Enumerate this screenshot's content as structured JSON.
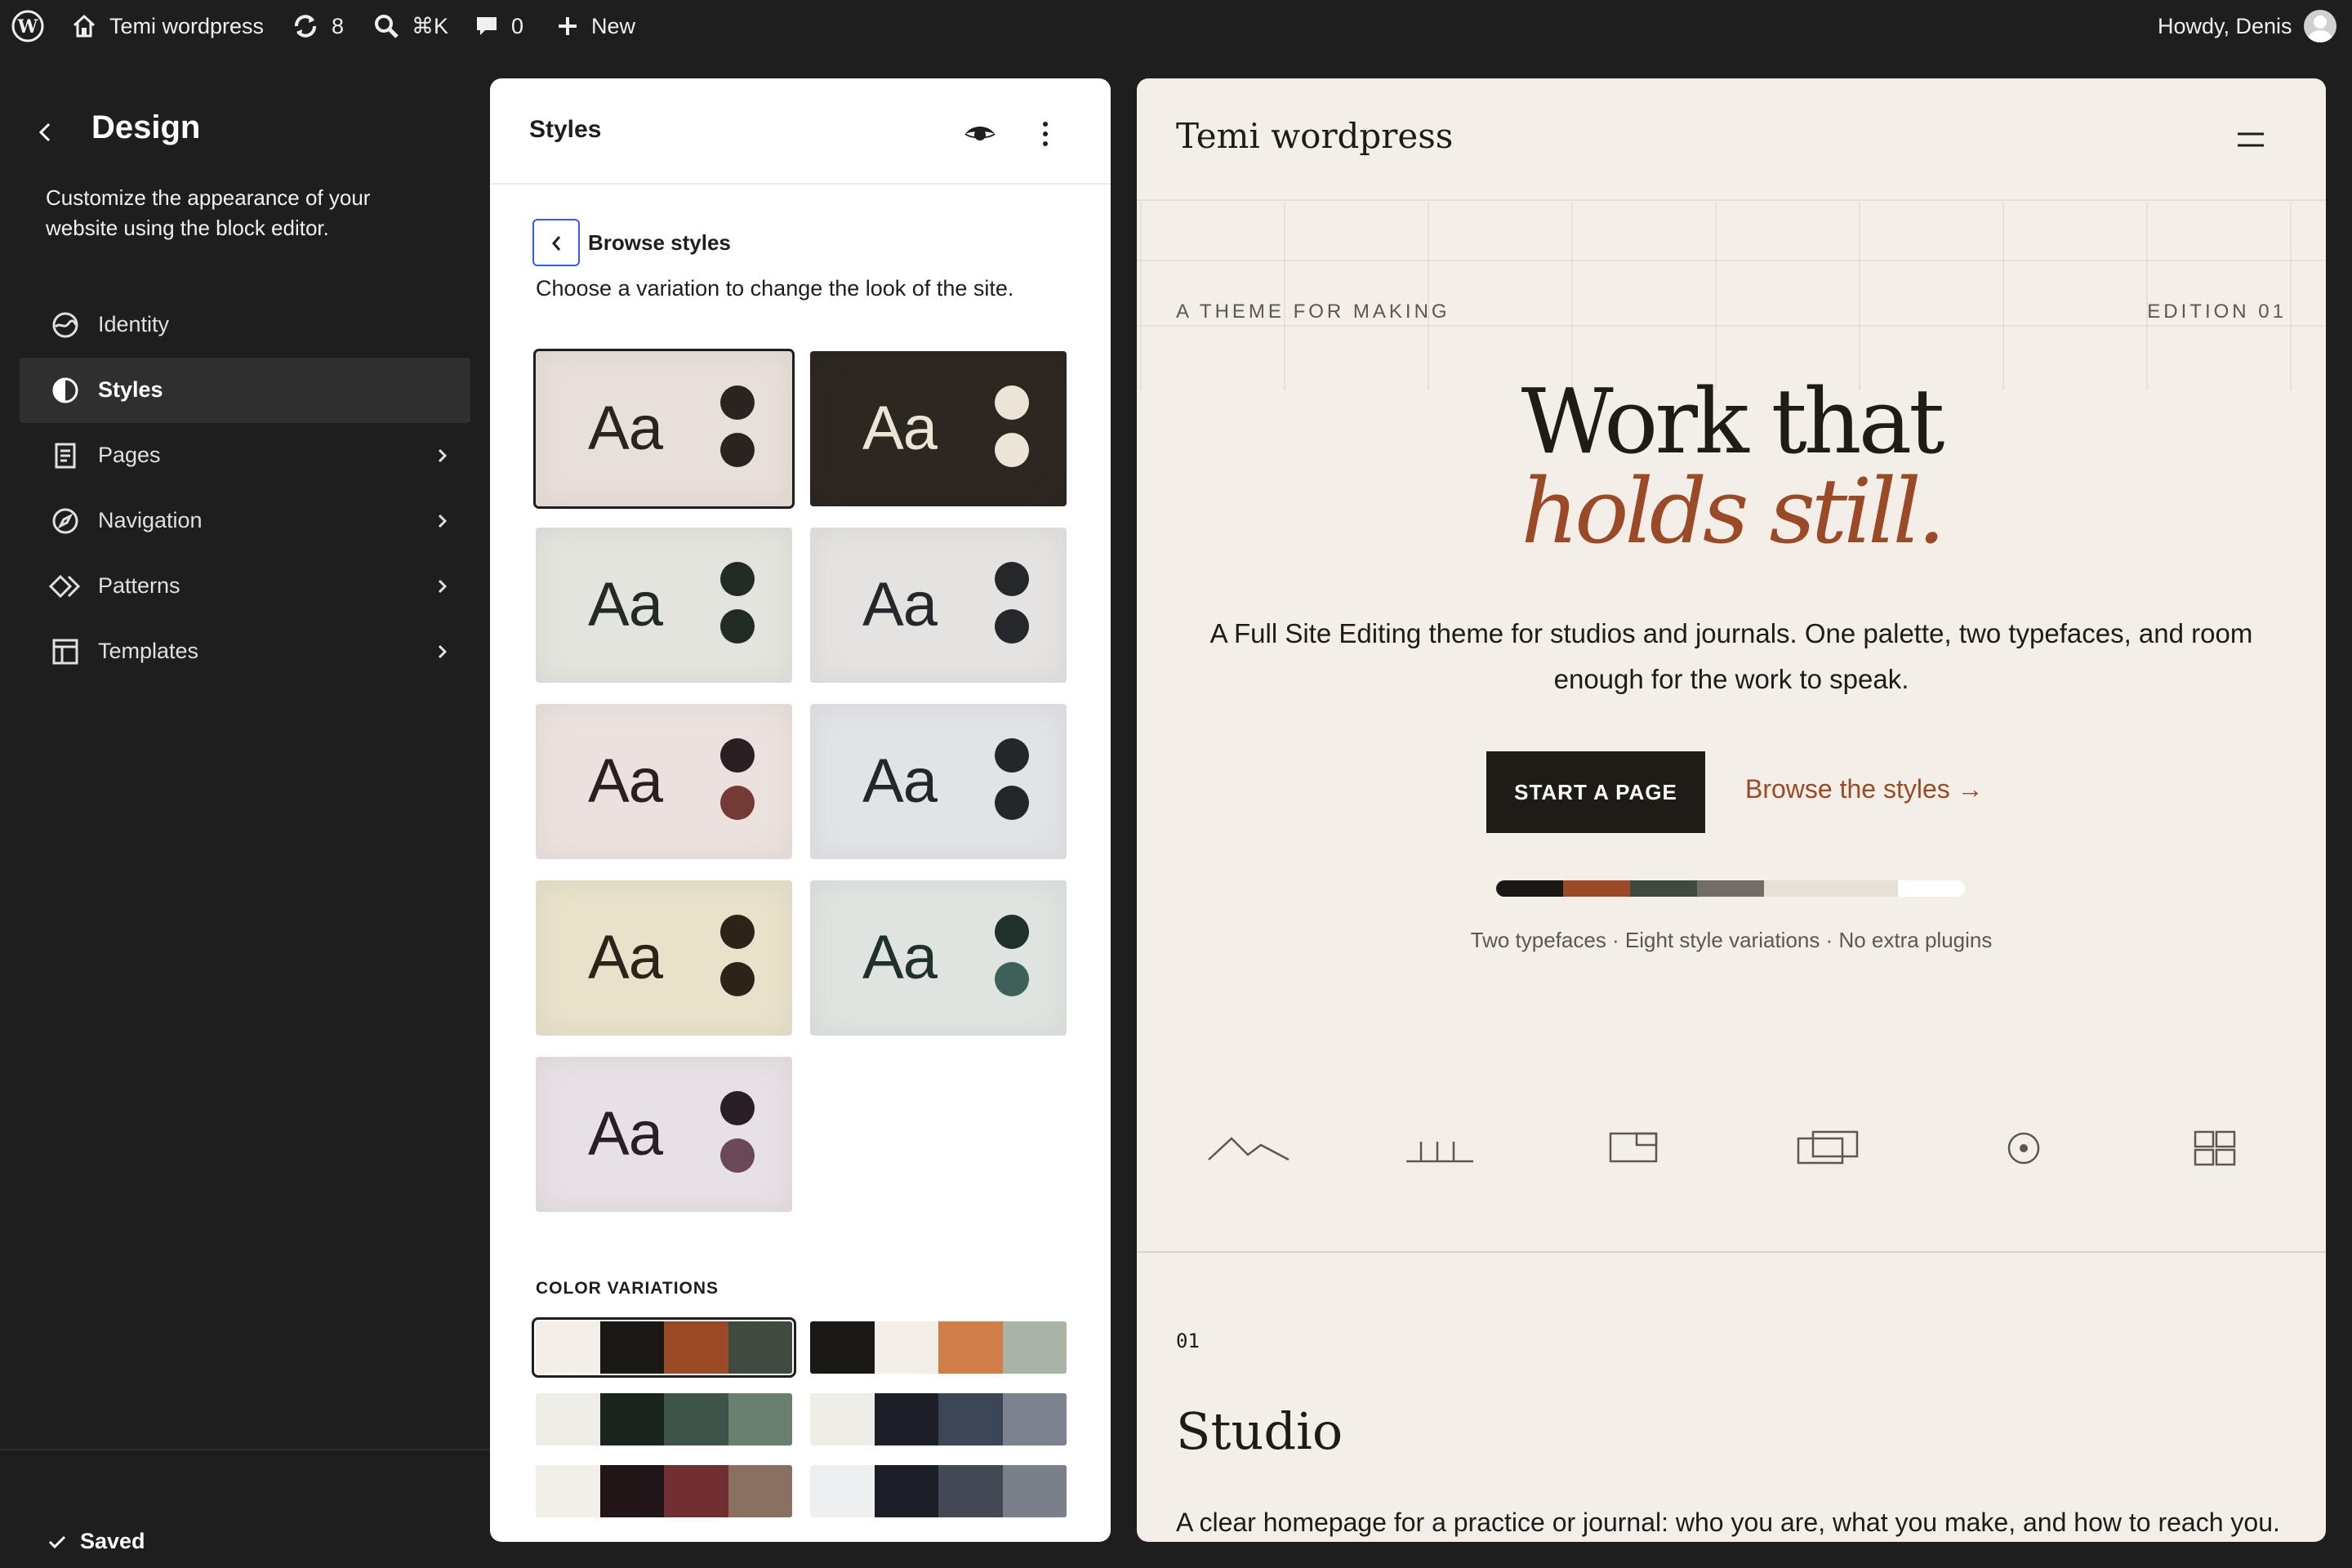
{
  "adminbar": {
    "wp_logo_icon": "wordpress-logo-icon",
    "site_name": "Temi wordpress",
    "updates_count": "8",
    "search_shortcut": "⌘K",
    "comments_count": "0",
    "new_label": "New",
    "howdy": "Howdy, Denis"
  },
  "sidebar": {
    "title": "Design",
    "description": "Customize the appearance of your website using the block editor.",
    "items": [
      {
        "label": "Identity",
        "icon": "identity-icon",
        "has_chevron": false
      },
      {
        "label": "Styles",
        "icon": "styles-icon",
        "has_chevron": false,
        "active": true
      },
      {
        "label": "Pages",
        "icon": "pages-icon",
        "has_chevron": true
      },
      {
        "label": "Navigation",
        "icon": "navigation-icon",
        "has_chevron": true
      },
      {
        "label": "Patterns",
        "icon": "patterns-icon",
        "has_chevron": true
      },
      {
        "label": "Templates",
        "icon": "templates-icon",
        "has_chevron": true
      }
    ],
    "status": "Saved"
  },
  "panel": {
    "title": "Styles",
    "browse_label": "Browse styles",
    "browse_description": "Choose a variation to change the look of the site.",
    "style_variations": [
      {
        "text": "Aa",
        "bg": "#e7e0d8",
        "fg": "#2a2420",
        "dot1": "#2a2420",
        "dot2": "#2a2420",
        "selected": true
      },
      {
        "text": "Aa",
        "bg": "#2d2722",
        "fg": "#ede4d8",
        "dot1": "#ede4d8",
        "dot2": "#ede4d8"
      },
      {
        "text": "Aa",
        "bg": "#e3e4de",
        "fg": "#232b25",
        "dot1": "#232b25",
        "dot2": "#232b25"
      },
      {
        "text": "Aa",
        "bg": "#e5e3e1",
        "fg": "#25272b",
        "dot1": "#25272b",
        "dot2": "#25272b"
      },
      {
        "text": "Aa",
        "bg": "#ebe2df",
        "fg": "#2a2024",
        "dot1": "#2a2024",
        "dot2": "#743a36"
      },
      {
        "text": "Aa",
        "bg": "#e2e3e7",
        "fg": "#24262c",
        "dot1": "#24262c",
        "dot2": "#24262c"
      },
      {
        "text": "Aa",
        "bg": "#e8e2cb",
        "fg": "#2a2518",
        "dot1": "#2a2518",
        "dot2": "#2a2518"
      },
      {
        "text": "Aa",
        "bg": "#dfe4e1",
        "fg": "#20302b",
        "dot1": "#20302b",
        "dot2": "#3d6059"
      },
      {
        "text": "Aa",
        "bg": "#e7e0e4",
        "fg": "#2a1f26",
        "dot1": "#2a1f26",
        "dot2": "#6a4858"
      }
    ],
    "color_variations_heading": "COLOR VARIATIONS",
    "color_variations": [
      {
        "colors": [
          "#f3eee7",
          "#1a1814",
          "#9a4a27",
          "#3f4a40"
        ],
        "selected": true
      },
      {
        "colors": [
          "#1a1814",
          "#f3eee7",
          "#d07d4a",
          "#a9b3a6"
        ]
      },
      {
        "colors": [
          "#eeede8",
          "#1c241f",
          "#3f5448",
          "#6b7f70"
        ]
      },
      {
        "colors": [
          "#eeede8",
          "#1c1f25",
          "#3d4656",
          "#7d8290"
        ]
      },
      {
        "colors": [
          "#f2eee8",
          "#211518",
          "#722f33",
          "#8a7060"
        ]
      },
      {
        "colors": [
          "#eeeff1",
          "#1b1e24",
          "#434854",
          "#7b7f8a"
        ]
      }
    ]
  },
  "preview": {
    "site_title": "Temi wordpress",
    "eyebrow": "A THEME FOR MAKING",
    "edition": "EDITION 01",
    "headline_line1": "Work that",
    "headline_line2": "holds still.",
    "lede": "A Full Site Editing theme for studios and journals. One palette, two typefaces, and room enough for the work to speak.",
    "cta_label": "START A PAGE",
    "link_label": "Browse the styles →",
    "palette": [
      "#1a1814",
      "#9a4a27",
      "#3f4a40",
      "#716c66",
      "#e7e0d5",
      "#e7e0d5",
      "#ffffff"
    ],
    "meta": "Two typefaces · Eight style variations · No extra plugins",
    "icons": [
      "mountain-line-icon",
      "bar-baseline-icon",
      "image-frame-icon",
      "stacked-frames-icon",
      "circle-dot-icon",
      "grid-layout-icon"
    ],
    "section_number": "01",
    "section_title": "Studio",
    "section_body": "A clear homepage for a practice or journal: who you are, what you make, and how to reach you."
  }
}
